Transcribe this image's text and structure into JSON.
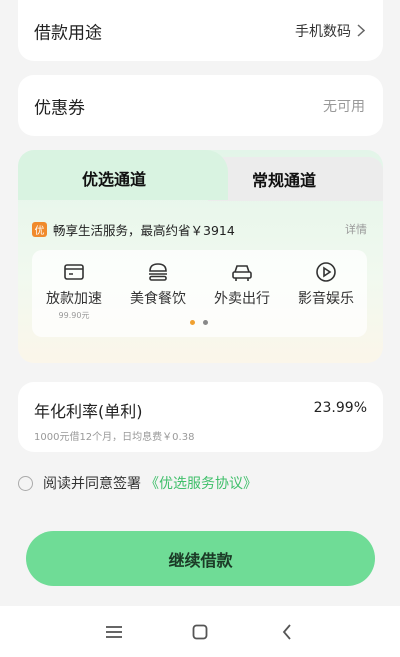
{
  "purpose": {
    "label": "借款用途",
    "value": "手机数码",
    "chevron_icon": "chevron-right-icon"
  },
  "coupon": {
    "label": "优惠券",
    "value": "无可用"
  },
  "channels": {
    "tabs": [
      {
        "label": "优选通道",
        "active": true
      },
      {
        "label": "常规通道",
        "active": false
      }
    ],
    "promo": {
      "badge": "优",
      "text": "畅享生活服务，最高约省￥3914",
      "detail": "详情"
    },
    "services": [
      {
        "label": "放款加速",
        "sub": "99.90元",
        "icon": "payment-card-icon"
      },
      {
        "label": "美食餐饮",
        "sub": "",
        "icon": "burger-icon"
      },
      {
        "label": "外卖出行",
        "sub": "",
        "icon": "car-icon"
      },
      {
        "label": "影音娱乐",
        "sub": "",
        "icon": "play-icon"
      }
    ],
    "pager": {
      "pages": 2,
      "current": 1
    }
  },
  "rate": {
    "title": "年化利率(单利)",
    "value": "23.99%",
    "sub": "1000元借12个月，日均息费￥0.38"
  },
  "agreement": {
    "text": "阅读并同意签署",
    "link": "《优选服务协议》",
    "checked": false
  },
  "continue_button": {
    "label": "继续借款"
  },
  "colors": {
    "accent": "#6fdc96",
    "link": "#3fbf6a",
    "badge": "#f08a2c"
  }
}
